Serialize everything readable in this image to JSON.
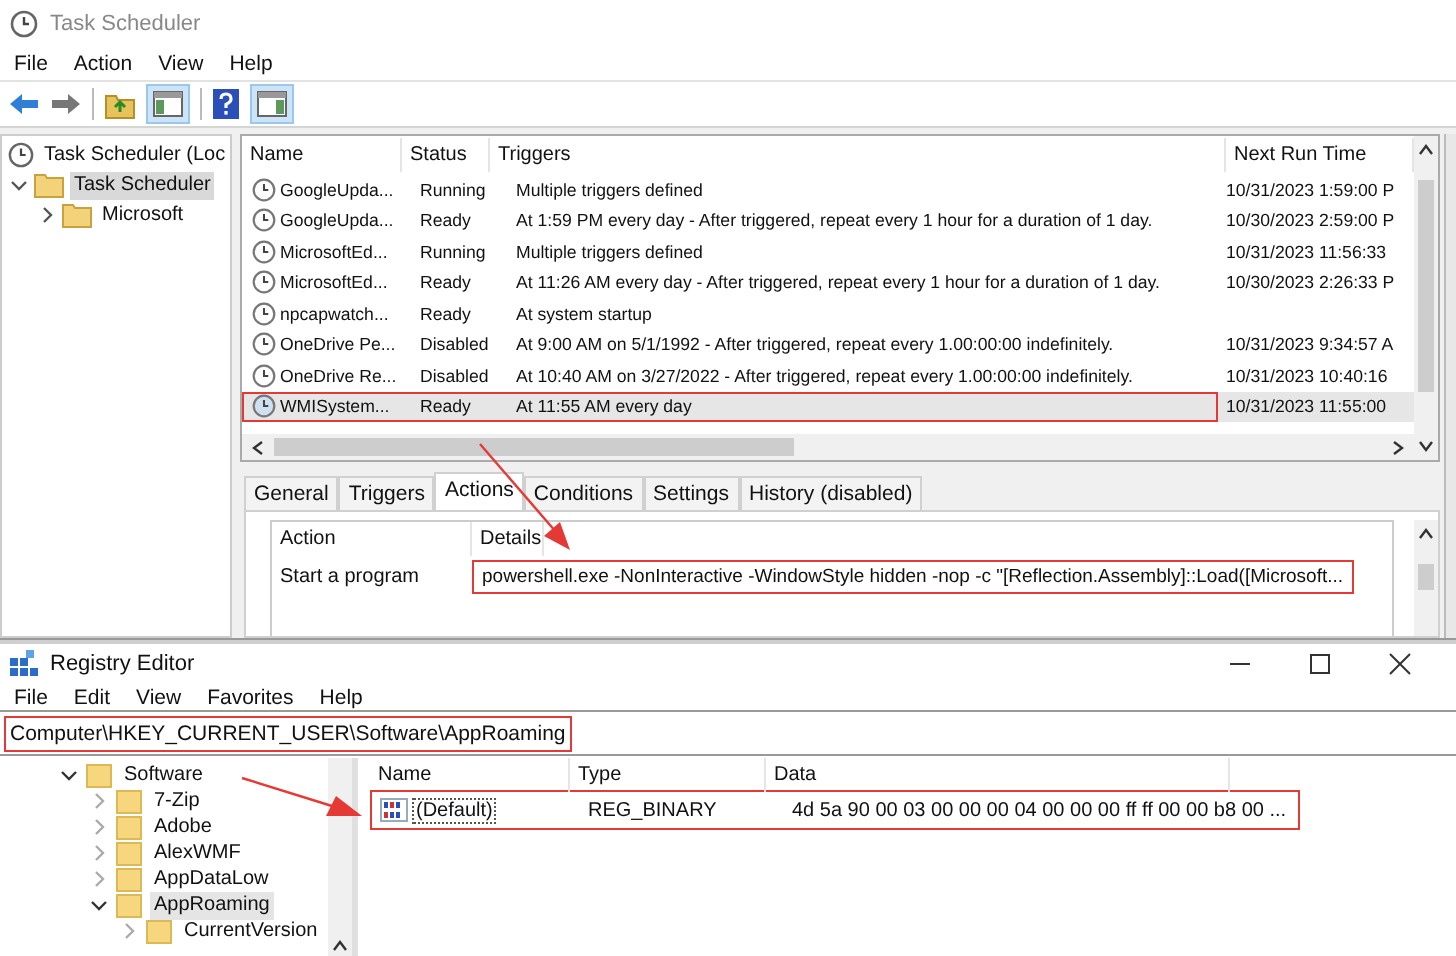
{
  "task_scheduler": {
    "window": {
      "title": "Task Scheduler"
    },
    "menu": [
      "File",
      "Action",
      "View",
      "Help"
    ],
    "root": {
      "label": "Task Scheduler (Loc"
    },
    "tree": [
      {
        "label": "Task Scheduler",
        "selected": true,
        "expanded": true,
        "children": [
          {
            "label": "Microsoft",
            "selected": false,
            "expanded": false
          }
        ]
      }
    ],
    "columns": [
      "Name",
      "Status",
      "Triggers",
      "Next Run Time"
    ],
    "tasks": [
      {
        "name": "GoogleUpda...",
        "status": "Running",
        "triggers": "Multiple triggers defined",
        "next_run": "10/31/2023 1:59:00 P",
        "selected": false,
        "annotated": false
      },
      {
        "name": "GoogleUpda...",
        "status": "Ready",
        "triggers": "At 1:59 PM every day - After triggered, repeat every 1 hour for a duration of 1 day.",
        "next_run": "10/30/2023 2:59:00 P",
        "selected": false,
        "annotated": false
      },
      {
        "name": "MicrosoftEd...",
        "status": "Running",
        "triggers": "Multiple triggers defined",
        "next_run": "10/31/2023 11:56:33",
        "selected": false,
        "annotated": false
      },
      {
        "name": "MicrosoftEd...",
        "status": "Ready",
        "triggers": "At 11:26 AM every day - After triggered, repeat every 1 hour for a duration of 1 day.",
        "next_run": "10/30/2023 2:26:33 P",
        "selected": false,
        "annotated": false
      },
      {
        "name": "npcapwatch...",
        "status": "Ready",
        "triggers": "At system startup",
        "selected": false,
        "annotated": false
      },
      {
        "name": "OneDrive Pe...",
        "status": "Disabled",
        "triggers": "At 9:00 AM on 5/1/1992 - After triggered, repeat every 1.00:00:00 indefinitely.",
        "next_run": "10/31/2023 9:34:57 A",
        "selected": false,
        "annotated": false
      },
      {
        "name": "OneDrive Re...",
        "status": "Disabled",
        "triggers": "At 10:40 AM on 3/27/2022 - After triggered, repeat every 1.00:00:00 indefinitely.",
        "next_run": "10/31/2023 10:40:16",
        "selected": false,
        "annotated": false
      },
      {
        "name": "WMISystem...",
        "status": "Ready",
        "triggers": "At 11:55 AM every day",
        "next_run": "10/31/2023 11:55:00",
        "selected": true,
        "annotated": true
      }
    ],
    "detail_tabs": [
      {
        "label": "General",
        "selected": false
      },
      {
        "label": "Triggers",
        "selected": false
      },
      {
        "label": "Actions",
        "selected": true
      },
      {
        "label": "Conditions",
        "selected": false
      },
      {
        "label": "Settings",
        "selected": false
      },
      {
        "label": "History (disabled)",
        "selected": false
      }
    ],
    "actions": {
      "columns": [
        "Action",
        "Details"
      ],
      "rows": [
        {
          "action": "Start a program",
          "details": "powershell.exe -NonInteractive -WindowStyle hidden -nop -c \"[Reflection.Assembly]::Load([Microsoft...",
          "annotated": true
        }
      ]
    }
  },
  "registry_editor": {
    "window": {
      "title": "Registry Editor"
    },
    "menu": [
      "File",
      "Edit",
      "View",
      "Favorites",
      "Help"
    ],
    "address": {
      "value": "Computer\\HKEY_CURRENT_USER\\Software\\AppRoaming",
      "annotated": true
    },
    "tree": [
      {
        "label": "Software",
        "selected": false,
        "expanded": true,
        "children": [
          {
            "label": "7-Zip",
            "selected": false,
            "expanded": false
          },
          {
            "label": "Adobe",
            "selected": false,
            "expanded": false
          },
          {
            "label": "AlexWMF",
            "selected": false,
            "expanded": false
          },
          {
            "label": "AppDataLow",
            "selected": false,
            "expanded": false
          },
          {
            "label": "AppRoaming",
            "selected": true,
            "expanded": true,
            "children": [
              {
                "label": "CurrentVersion",
                "selected": false,
                "expanded": false
              }
            ]
          }
        ]
      }
    ],
    "columns": [
      "Name",
      "Type",
      "Data"
    ],
    "values": [
      {
        "name": "(Default)",
        "type": "REG_BINARY",
        "data": "4d 5a 90 00 03 00 00 00 04 00 00 00 ff ff 00 00 b8 00 ...",
        "focused": true,
        "annotated": true
      }
    ]
  }
}
